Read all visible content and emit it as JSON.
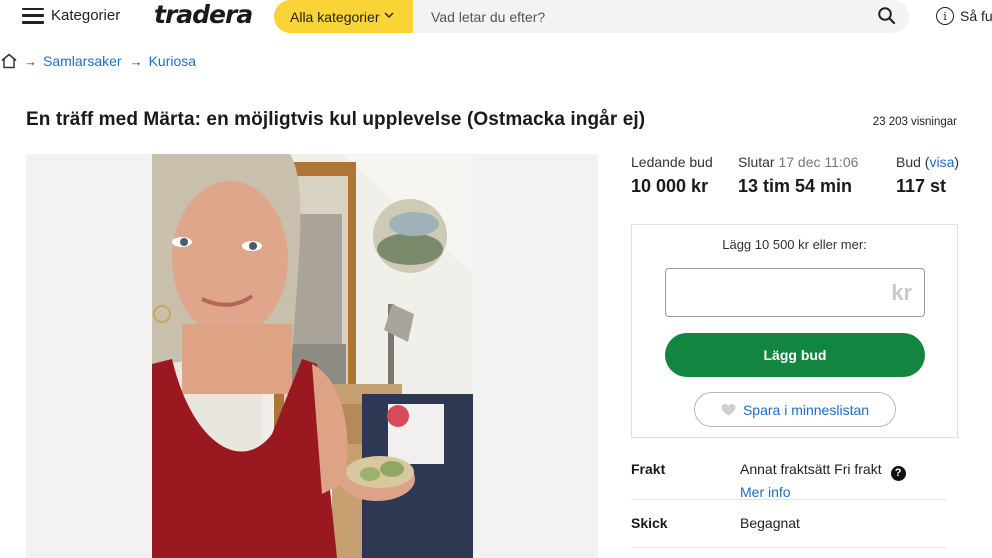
{
  "header": {
    "menu_label": "Kategorier",
    "logo": "tradera",
    "category_select": "Alla kategorier",
    "search_placeholder": "Vad letar du efter?",
    "howto_label": "Så fu"
  },
  "breadcrumb": [
    "Samlarsaker",
    "Kuriosa"
  ],
  "listing": {
    "title": "En träff med Märta: en möjligtvis kul upplevelse (Ostmacka ingår ej)",
    "views_count": "23 203",
    "views_label": "visningar"
  },
  "bid_stats": {
    "leading_label": "Ledande bud",
    "leading_value": "10 000 kr",
    "ends_label": "Slutar",
    "ends_date": "17 dec 11:06",
    "ends_value": "13 tim 54 min",
    "bids_label": "Bud",
    "bids_link": "visa",
    "bids_value": "117 st"
  },
  "bid_box": {
    "hint": "Lägg 10 500 kr eller mer:",
    "input_value": "",
    "currency": "kr",
    "bid_button": "Lägg bud",
    "save_button": "Spara i minneslistan"
  },
  "details": {
    "shipping_label": "Frakt",
    "shipping_value": "Annat fraktsätt Fri frakt",
    "shipping_link": "Mer info",
    "condition_label": "Skick",
    "condition_value": "Begagnat"
  },
  "colors": {
    "accent_yellow": "#f9d437",
    "bid_green": "#128540",
    "link_blue": "#1a6fc4"
  }
}
